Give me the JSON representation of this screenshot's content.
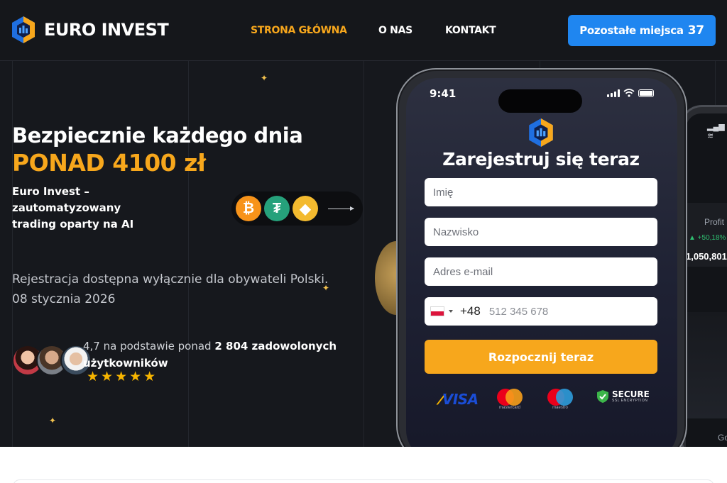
{
  "header": {
    "brand": "EURO INVEST",
    "nav": [
      {
        "label": "STRONA GŁÓWNA",
        "active": true
      },
      {
        "label": "O NAS",
        "active": false
      },
      {
        "label": "KONTAKT",
        "active": false
      }
    ],
    "cta_label": "Pozostałe miejsca",
    "cta_count": "37"
  },
  "hero": {
    "headline": "Bezpiecznie każdego dnia",
    "highlight": "PONAD 4100 zł",
    "tagline": "Euro Invest – zautomatyzowany trading oparty na AI",
    "notice_line1": "Rejestracja dostępna wyłącznie dla obywateli Polski.",
    "notice_line2": "08 stycznia 2026",
    "rating_prefix": "4,7 na podstawie ponad",
    "rating_bold": "2 804 zadowolonych użytkowników",
    "stars": "★★★★★",
    "coins": [
      {
        "name": "bitcoin-icon",
        "glyph": "₿"
      },
      {
        "name": "tether-icon",
        "glyph": "₮"
      },
      {
        "name": "binance-icon",
        "glyph": "◆"
      }
    ]
  },
  "phone": {
    "time": "9:41",
    "form_title": "Zarejestruj się teraz",
    "first_name_placeholder": "Imię",
    "last_name_placeholder": "Nazwisko",
    "email_placeholder": "Adres e-mail",
    "dial_code": "+48",
    "phone_placeholder": "512 345 678",
    "submit_label": "Rozpocznij teraz",
    "payments": {
      "visa": "VISA",
      "mastercard": "mastercard",
      "maestro": "maestro",
      "secure_title": "SECURE",
      "secure_sub": "SSL ENCRYPTION"
    }
  },
  "back_phone": {
    "profit_label": "Profit",
    "profit_pct": "▲ +50,18%",
    "profit_value": "1,050,801",
    "bottom_label": "Go"
  },
  "colors": {
    "accent_orange": "#f7a71c",
    "cta_blue": "#1f86f0",
    "background": "#16181d"
  }
}
